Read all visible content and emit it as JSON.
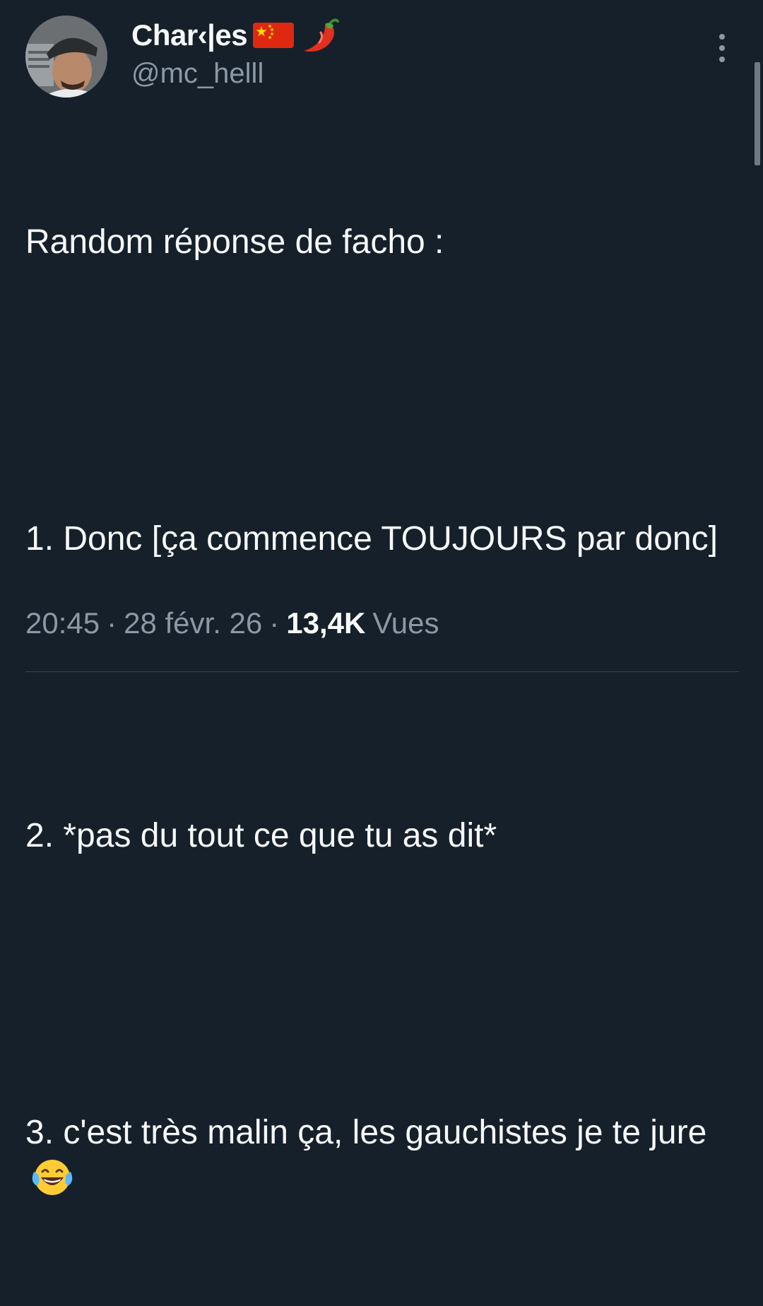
{
  "author": {
    "display_name": "Char‹|es",
    "emoji_flag": "china-flag",
    "emoji_extra": "chili-pepper",
    "handle": "@mc_helll"
  },
  "tweet": {
    "intro": "Random réponse de facho :",
    "item1": "1. Donc [ça commence TOUJOURS par donc]",
    "item2": "2. *pas du tout ce que tu as dit*",
    "item3": "3. c'est très malin ça, les gauchistes je te jure",
    "item3_emoji": "face-with-tears-of-joy"
  },
  "meta": {
    "time": "20:45",
    "separator1": "·",
    "date": "28 févr. 26",
    "separator2": "·",
    "views_count": "13,4K",
    "views_label": "Vues"
  },
  "colors": {
    "background": "#15202b",
    "primary_text": "#f7f9f9",
    "secondary_text": "#8b98a5"
  }
}
